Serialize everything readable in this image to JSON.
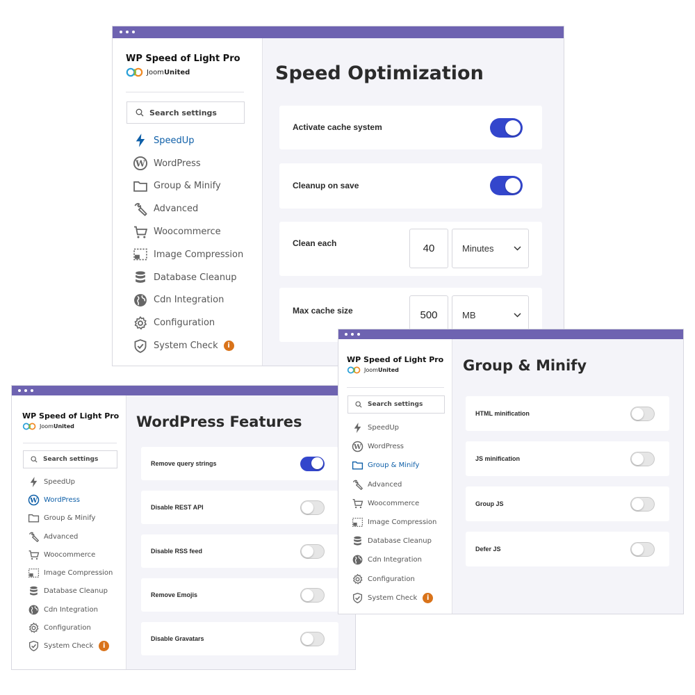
{
  "colors": {
    "accent": "#3346cc",
    "titlebar": "#6e63b1",
    "active_nav": "#0e5fa8",
    "info_badge": "#d9731a"
  },
  "app": {
    "name": "WP Speed of Light Pro",
    "vendor_light": "Joom",
    "vendor_bold": "United"
  },
  "search": {
    "placeholder": "Search settings"
  },
  "nav": [
    {
      "label": "SpeedUp",
      "icon": "bolt-icon"
    },
    {
      "label": "WordPress",
      "icon": "wordpress-icon"
    },
    {
      "label": "Group & Minify",
      "icon": "folder-icon"
    },
    {
      "label": "Advanced",
      "icon": "wrench-icon"
    },
    {
      "label": "Woocommerce",
      "icon": "cart-icon"
    },
    {
      "label": "Image Compression",
      "icon": "image-compression-icon"
    },
    {
      "label": "Database Cleanup",
      "icon": "database-icon"
    },
    {
      "label": "Cdn Integration",
      "icon": "globe-icon"
    },
    {
      "label": "Configuration",
      "icon": "gear-icon"
    },
    {
      "label": "System Check",
      "icon": "shield-check-icon",
      "badge": "i"
    }
  ],
  "speed": {
    "title": "Speed Optimization",
    "active_nav": "SpeedUp",
    "settings": [
      {
        "label": "Activate cache system",
        "enabled": true
      },
      {
        "label": "Cleanup on save",
        "enabled": true
      },
      {
        "label": "Clean each",
        "value": "40",
        "unit": "Minutes"
      },
      {
        "label": "Max cache size",
        "value": "500",
        "unit": "MB"
      }
    ]
  },
  "wordpress": {
    "title": "WordPress Features",
    "active_nav": "WordPress",
    "settings": [
      {
        "label": "Remove query strings",
        "enabled": true
      },
      {
        "label": "Disable REST API",
        "enabled": false
      },
      {
        "label": "Disable RSS feed",
        "enabled": false
      },
      {
        "label": "Remove Emojis",
        "enabled": false
      },
      {
        "label": "Disable Gravatars",
        "enabled": false
      }
    ]
  },
  "group": {
    "title": "Group & Minify",
    "active_nav": "Group & Minify",
    "settings": [
      {
        "label": "HTML minification",
        "enabled": false
      },
      {
        "label": "JS minification",
        "enabled": false
      },
      {
        "label": "Group JS",
        "enabled": false
      },
      {
        "label": "Defer JS",
        "enabled": false
      }
    ]
  }
}
